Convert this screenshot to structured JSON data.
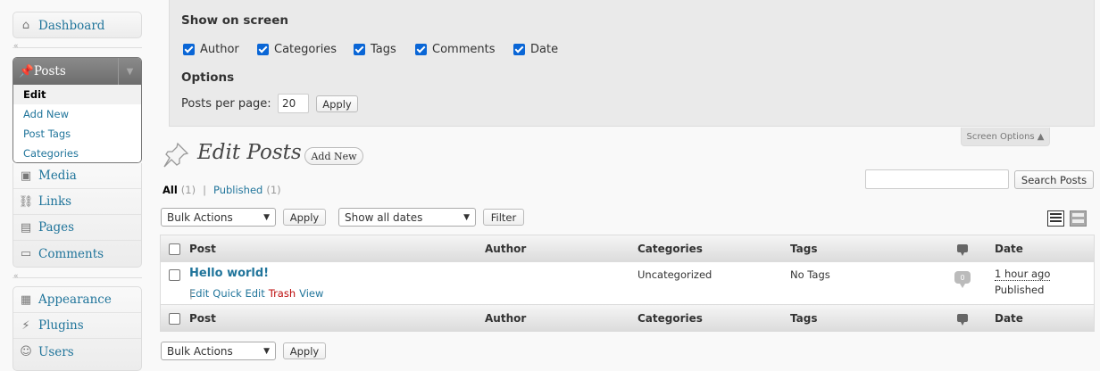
{
  "sidebar": {
    "dashboard": "Dashboard",
    "posts": "Posts",
    "posts_sub": [
      "Edit",
      "Add New",
      "Post Tags",
      "Categories"
    ],
    "media": "Media",
    "links": "Links",
    "pages": "Pages",
    "comments": "Comments",
    "appearance": "Appearance",
    "plugins": "Plugins",
    "users": "Users"
  },
  "screen_options": {
    "show_on_screen": "Show on screen",
    "columns": [
      "Author",
      "Categories",
      "Tags",
      "Comments",
      "Date"
    ],
    "options_heading": "Options",
    "per_page_label": "Posts per page:",
    "per_page_value": "20",
    "apply": "Apply",
    "tab_label": "Screen Options ▲"
  },
  "page": {
    "title": "Edit Posts",
    "add_new": "Add New"
  },
  "filters": {
    "all": "All",
    "all_count": "(1)",
    "sep": "|",
    "published": "Published",
    "published_count": "(1)"
  },
  "search": {
    "value": "",
    "button": "Search Posts"
  },
  "tablenav": {
    "bulk_actions": "Bulk Actions",
    "apply": "Apply",
    "dates": "Show all dates",
    "filter": "Filter"
  },
  "table": {
    "headers": {
      "post": "Post",
      "author": "Author",
      "categories": "Categories",
      "tags": "Tags",
      "date": "Date"
    },
    "rows": [
      {
        "title": "Hello world!",
        "actions": [
          "Edit",
          "Quick Edit",
          "Trash",
          "View"
        ],
        "author": "",
        "categories": "Uncategorized",
        "tags": "No Tags",
        "comments": "0",
        "date": "1 hour ago",
        "status": "Published"
      }
    ]
  },
  "colors": {
    "link": "#21759b",
    "trash": "#bc0b0b",
    "checkbox": "#0a66d6"
  }
}
